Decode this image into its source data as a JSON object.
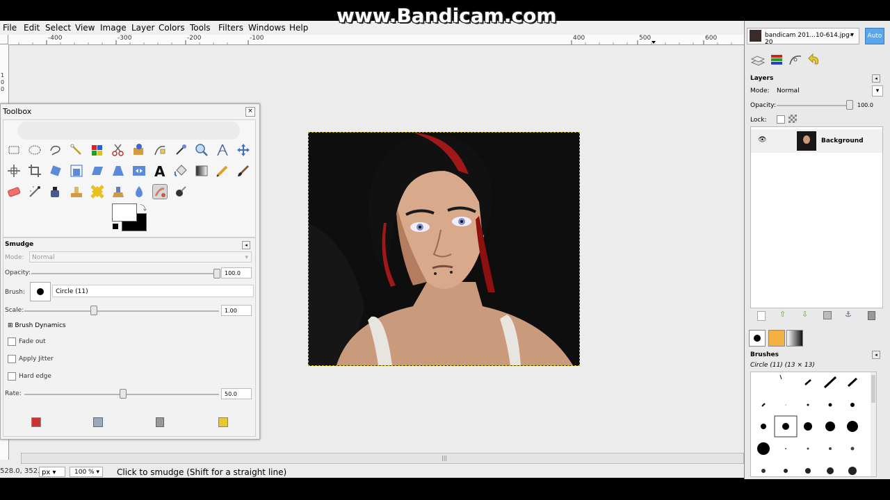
{
  "menubar": {
    "items": [
      "File",
      "Edit",
      "Select",
      "View",
      "Image",
      "Layer",
      "Colors",
      "Tools",
      "Filters",
      "Windows",
      "Help"
    ]
  },
  "watermark": "www.Bandicam.com",
  "ruler": {
    "h_labels": [
      "-400",
      "-300",
      "-200",
      "-100",
      "400",
      "500",
      "600"
    ],
    "v_labels": [
      "1",
      "0",
      "0"
    ]
  },
  "toolbox": {
    "title": "Toolbox",
    "tools": [
      "rect-select-icon",
      "ellipse-select-icon",
      "lasso-icon",
      "fuzzy-select-icon",
      "color-select-icon",
      "scissors-icon",
      "foreground-select-icon",
      "paths-icon",
      "color-picker-icon",
      "zoom-icon",
      "measure-icon",
      "move-icon",
      "align-icon",
      "crop-icon",
      "rotate-icon",
      "scale-icon",
      "shear-icon",
      "perspective-icon",
      "flip-icon",
      "text-icon",
      "bucket-fill-icon",
      "blend-icon",
      "pencil-icon",
      "paintbrush-icon",
      "eraser-icon",
      "airbrush-icon",
      "ink-icon",
      "clone-icon",
      "heal-icon",
      "perspective-clone-icon",
      "blur-icon",
      "smudge-icon",
      "dodge-burn-icon"
    ],
    "options": {
      "title": "Smudge",
      "mode_label": "Mode:",
      "mode_value": "Normal",
      "opacity_label": "Opacity:",
      "opacity_value": "100.0",
      "opacity_level": 1.0,
      "brush_label": "Brush:",
      "brush_value": "Circle (11)",
      "scale_label": "Scale:",
      "scale_value": "1.00",
      "scale_level": 0.5,
      "brush_dynamics": "Brush Dynamics",
      "fade_out": "Fade out",
      "apply_jitter": "Apply Jitter",
      "hard_edge": "Hard edge",
      "rate_label": "Rate:",
      "rate_value": "50.0",
      "rate_level": 0.5
    }
  },
  "statusbar": {
    "coords": "528.0, 352.0",
    "unit": "px",
    "zoom": "100 %",
    "message": "Click to smudge (Shift for a straight line)"
  },
  "dock": {
    "image_selector": "bandicam 201...10-614.jpg-20",
    "auto_button": "Auto",
    "layers": {
      "title": "Layers",
      "mode_label": "Mode:",
      "mode_value": "Normal",
      "opacity_label": "Opacity:",
      "opacity_value": "100.0",
      "lock_label": "Lock:",
      "layer_name": "Background"
    },
    "brushes": {
      "title": "Brushes",
      "subtitle": "Circle (11) (13 × 13)"
    }
  },
  "colors": {
    "window_bg": "#ececec",
    "selection_border": "#c8b400",
    "accent_blue": "#5aa6e8"
  }
}
